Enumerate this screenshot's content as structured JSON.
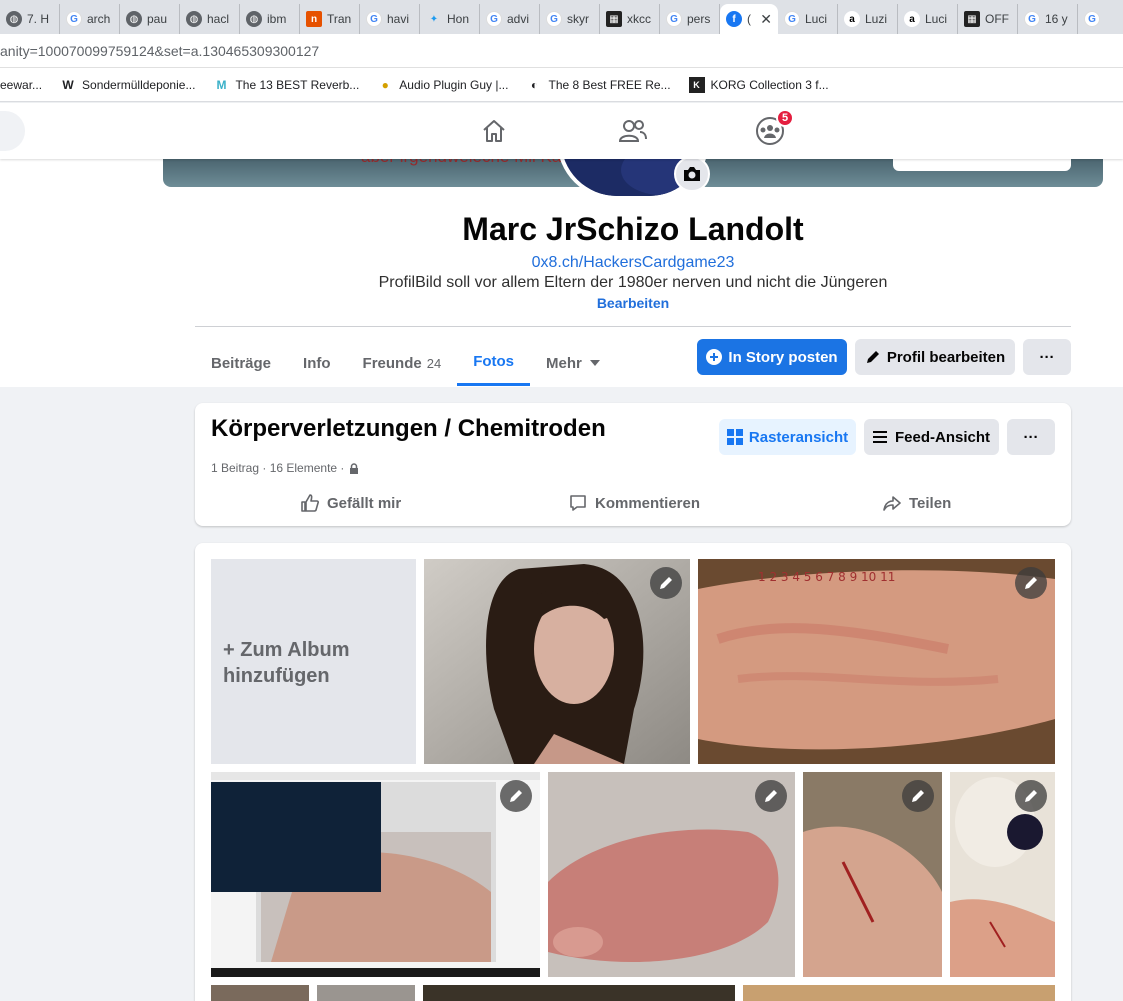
{
  "browser": {
    "tabs": [
      {
        "label": "7. H",
        "icon": "globe-icon",
        "kind": "globe"
      },
      {
        "label": "arch",
        "icon": "google-icon",
        "kind": "g"
      },
      {
        "label": "pau",
        "icon": "globe-icon",
        "kind": "globe"
      },
      {
        "label": "hacl",
        "icon": "globe-icon",
        "kind": "globe"
      },
      {
        "label": "ibm",
        "icon": "globe-icon",
        "kind": "globe"
      },
      {
        "label": "Tran",
        "icon": "translate-icon",
        "kind": "orange"
      },
      {
        "label": "havi",
        "icon": "google-icon",
        "kind": "g"
      },
      {
        "label": "Hon",
        "icon": "twitter-icon",
        "kind": "tw"
      },
      {
        "label": "advi",
        "icon": "google-icon",
        "kind": "g"
      },
      {
        "label": "skyr",
        "icon": "google-icon",
        "kind": "g"
      },
      {
        "label": "xkcc",
        "icon": "xkcd-icon",
        "kind": "dark"
      },
      {
        "label": "pers",
        "icon": "google-icon",
        "kind": "g"
      },
      {
        "label": "(",
        "icon": "facebook-icon",
        "kind": "fb",
        "active": true
      },
      {
        "label": "Luci",
        "icon": "google-icon",
        "kind": "g"
      },
      {
        "label": "Luzi",
        "icon": "amazon-icon",
        "kind": "amz"
      },
      {
        "label": "Luci",
        "icon": "amazon-icon",
        "kind": "amz"
      },
      {
        "label": "OFF",
        "icon": "off-icon",
        "kind": "dark"
      },
      {
        "label": "16 y",
        "icon": "google-icon",
        "kind": "g"
      },
      {
        "label": "",
        "icon": "google-icon",
        "kind": "g"
      }
    ],
    "url_prefix": "anity=100070099759124&set=a.130465309300127",
    "bookmarks": [
      {
        "label": "eewar...",
        "icon": ""
      },
      {
        "label": "Sondermülldeponie...",
        "icon": "W"
      },
      {
        "label": "The 13 BEST Reverb...",
        "icon": "M"
      },
      {
        "label": "Audio Plugin Guy |...",
        "icon": "●"
      },
      {
        "label": "The 8 Best FREE Re...",
        "icon": "◐"
      },
      {
        "label": "KORG Collection 3 f...",
        "icon": "K"
      }
    ]
  },
  "header": {
    "notification_count": "5"
  },
  "profile": {
    "cover_text": "aber irgendweleche Mil          Karten scheinbar nie",
    "name": "Marc JrSchizo Landolt",
    "link": "0x8.ch/HackersCardgame23",
    "bio": "ProfilBild soll vor allem Eltern der 1980er nerven und nicht die Jüngeren",
    "edit_bio": "Bearbeiten",
    "tabs": [
      {
        "label": "Beiträge",
        "count": ""
      },
      {
        "label": "Info",
        "count": ""
      },
      {
        "label": "Freunde",
        "count": "24"
      },
      {
        "label": "Fotos",
        "count": "",
        "active": true
      },
      {
        "label": "Mehr",
        "count": ""
      }
    ],
    "story_button": "In Story posten",
    "edit_profile_button": "Profil bearbeiten",
    "more_button": "···"
  },
  "album": {
    "title": "Körperverletzungen / Chemitroden",
    "meta": "1 Beitrag · 16 Elemente ·",
    "grid_view": "Rasteransicht",
    "feed_view": "Feed-Ansicht",
    "more": "···",
    "like": "Gefällt mir",
    "comment": "Kommentieren",
    "share": "Teilen",
    "add_to_album": "Zum Album hinzufügen",
    "add_line1": "+ Zum Album",
    "add_line2": "hinzufügen"
  },
  "colors": {
    "fb_blue": "#1877f2",
    "badge_red": "#e41e3f"
  }
}
